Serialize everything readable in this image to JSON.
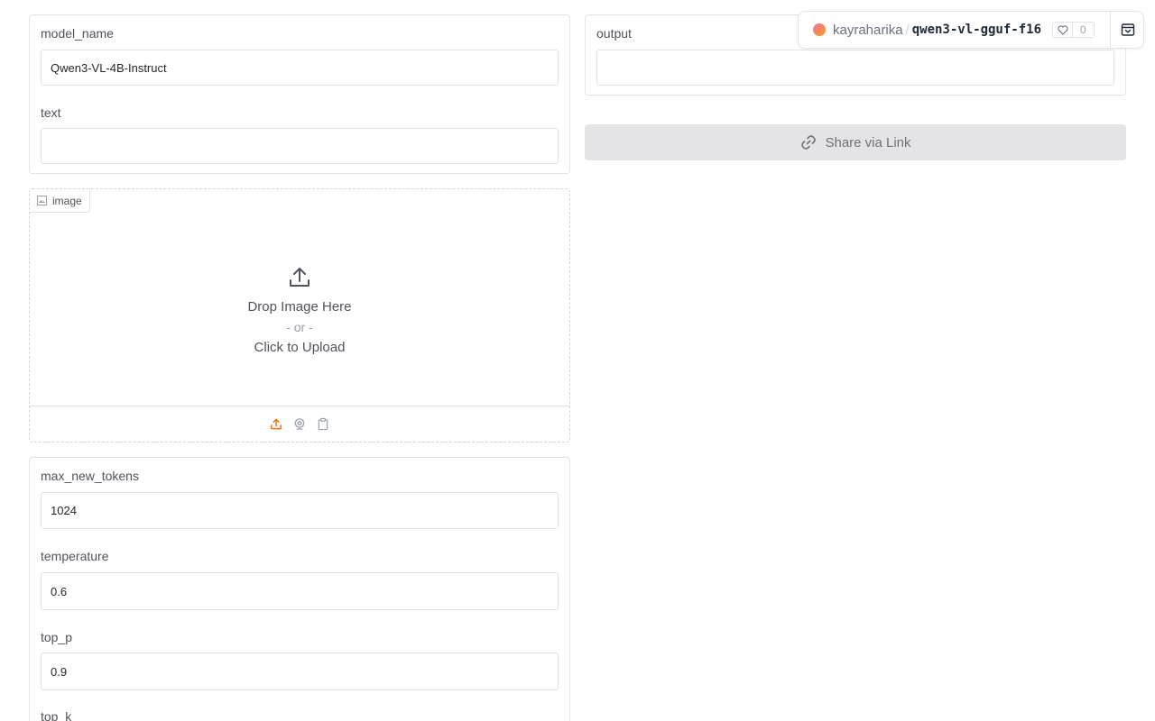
{
  "inputs": {
    "model_name": {
      "label": "model_name",
      "value": "Qwen3-VL-4B-Instruct"
    },
    "text": {
      "label": "text",
      "value": ""
    }
  },
  "image": {
    "label": "image",
    "drop_text": "Drop Image Here",
    "or_text": "- or -",
    "click_text": "Click to Upload",
    "tools": [
      "upload-icon",
      "webcam-icon",
      "clipboard-icon"
    ]
  },
  "params": {
    "max_new_tokens": {
      "label": "max_new_tokens",
      "value": "1024"
    },
    "temperature": {
      "label": "temperature",
      "value": "0.6"
    },
    "top_p": {
      "label": "top_p",
      "value": "0.9"
    },
    "top_k": {
      "label": "top_k"
    }
  },
  "output": {
    "label": "output",
    "value": ""
  },
  "share": {
    "label": "Share via Link"
  },
  "space": {
    "owner": "kayraharika",
    "separator": "/",
    "repo": "qwen3-vl-gguf-f16",
    "likes": "0"
  },
  "colors": {
    "accent": "#f97316",
    "border": "#e4e4e7",
    "share_bg": "#e4e4e7"
  }
}
